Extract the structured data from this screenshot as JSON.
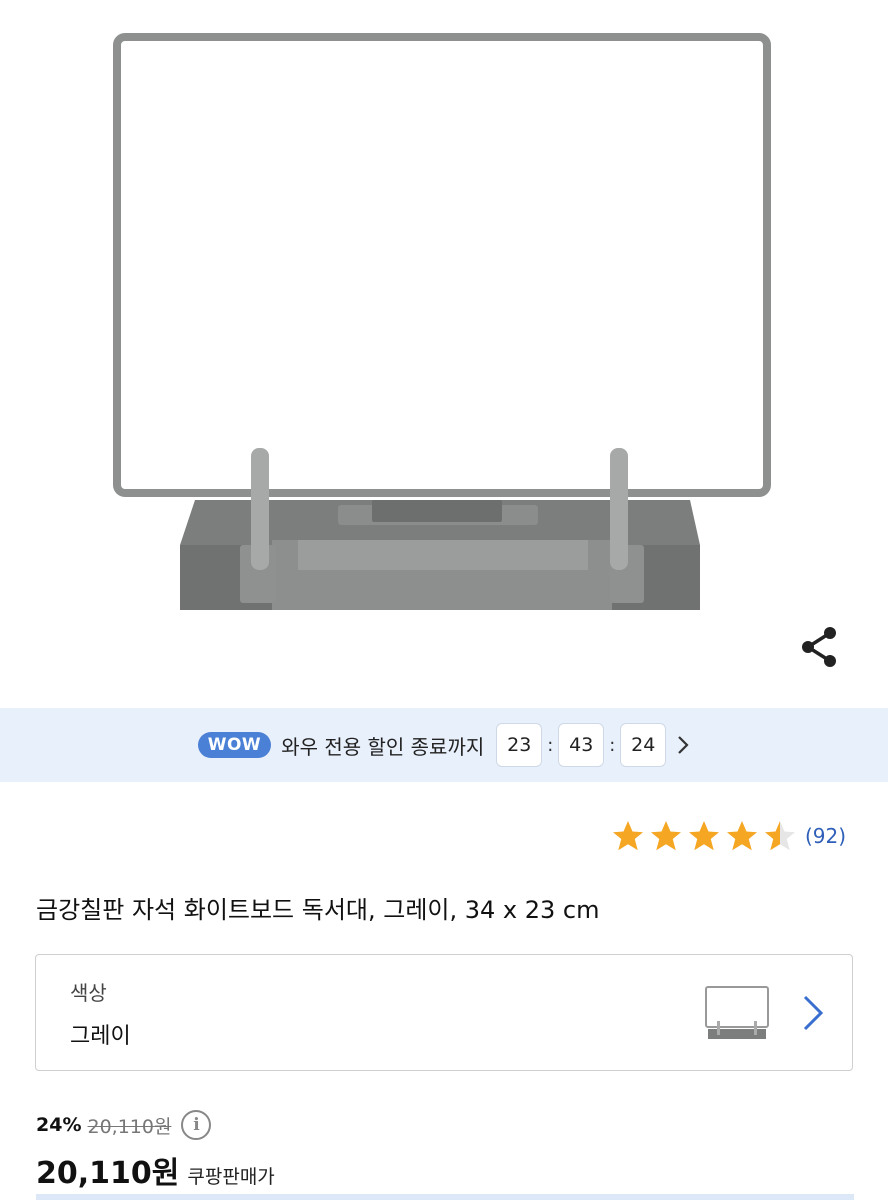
{
  "product": {
    "title": "금강칠판 자석 화이트보드 독서대, 그레이, 34 x 23 cm",
    "image_icon": "whiteboard-stand-image"
  },
  "share": {
    "icon": "share-icon"
  },
  "wow_banner": {
    "badge": "WOW",
    "text": "와우 전용 할인 종료까지",
    "timer": {
      "hours": "23",
      "minutes": "43",
      "seconds": "24",
      "separator": ":"
    }
  },
  "rating": {
    "stars": 4.5,
    "max_stars": 5,
    "review_count": "(92)"
  },
  "option": {
    "label": "색상",
    "value": "그레이"
  },
  "price": {
    "discount_rate": "24%",
    "original_price": "20,110원",
    "sale_price": "20,110원",
    "price_type": "쿠팡판매가",
    "info_icon": "i"
  },
  "colors": {
    "star": "#f5a623",
    "link": "#2f5fb8",
    "wow_badge": "#4a80d6",
    "banner_bg": "#e8f0fb"
  }
}
